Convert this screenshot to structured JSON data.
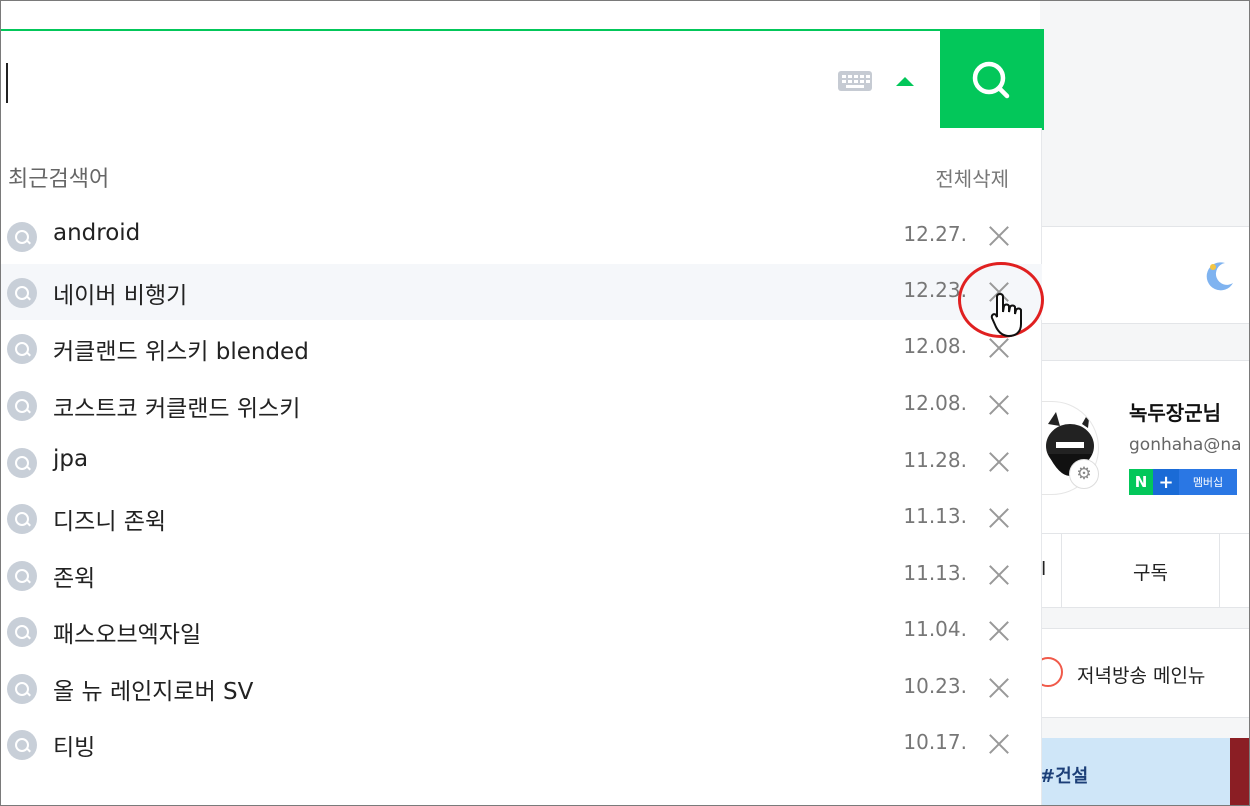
{
  "search": {
    "value": "",
    "keyboard_icon": "keyboard-icon",
    "toggle_icon": "caret-up-icon",
    "submit_icon": "search-icon",
    "accent_color": "#03c75a"
  },
  "recent": {
    "title": "최근검색어",
    "clear_all": "전체삭제",
    "items": [
      {
        "label": "android",
        "date": "12.27."
      },
      {
        "label": "네이버 비행기",
        "date": "12.23."
      },
      {
        "label": "커클랜드 위스키 blended",
        "date": "12.08."
      },
      {
        "label": "코스트코 커클랜드 위스키",
        "date": "12.08."
      },
      {
        "label": "jpa",
        "date": "11.28."
      },
      {
        "label": "디즈니 존윅",
        "date": "11.13."
      },
      {
        "label": "존윅",
        "date": "11.13."
      },
      {
        "label": "패스오브엑자일",
        "date": "11.04."
      },
      {
        "label": "올 뉴 레인지로버 SV",
        "date": "10.23."
      },
      {
        "label": "티빙",
        "date": "10.17."
      }
    ]
  },
  "background": {
    "profile_name": "녹두장군님",
    "profile_email": "gonhaha@na",
    "badge_n": "N",
    "badge_plus": "+",
    "badge_text": "멤버십",
    "tab_left": "l",
    "tab_subscribe": "구독",
    "news_text": "저녁방송 메인뉴",
    "banner_text": "#건설"
  }
}
